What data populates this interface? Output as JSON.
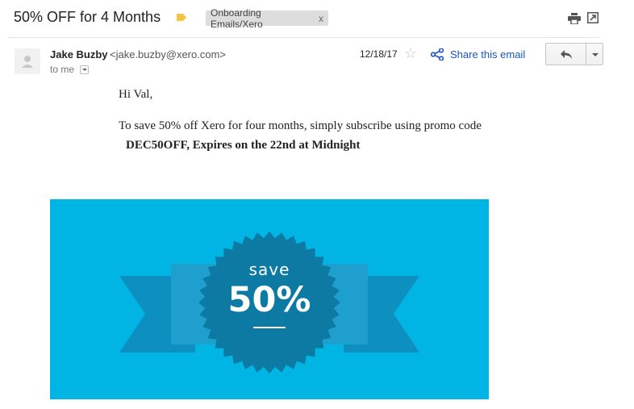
{
  "email": {
    "subject": "50% OFF for 4 Months",
    "label": {
      "text": "Onboarding Emails/Xero",
      "remove": "x"
    },
    "sender": {
      "name": "Jake Buzby",
      "email": "<jake.buzby@xero.com>"
    },
    "recipient": "to me",
    "date": "12/18/17",
    "share_label": "Share this email",
    "body": {
      "greeting": "Hi Val,",
      "paragraph": "To save 50% off Xero for four months, simply subscribe using promo code",
      "promo": "DEC50OFF, Expires on the 22nd at Midnight"
    },
    "banner": {
      "save_word": "save",
      "percent": "50%"
    }
  },
  "icons": {
    "label_tag": "label-tag-icon",
    "print": "print-icon",
    "popout": "popout-icon",
    "avatar": "avatar-icon",
    "star": "star-icon",
    "share": "share-icon",
    "reply": "reply-icon",
    "more": "chevron-down-icon"
  },
  "colors": {
    "banner": "#00b4e4",
    "banner_dark": "#0c7aa3",
    "label_tag": "#f5c542",
    "link": "#1a55c8"
  }
}
